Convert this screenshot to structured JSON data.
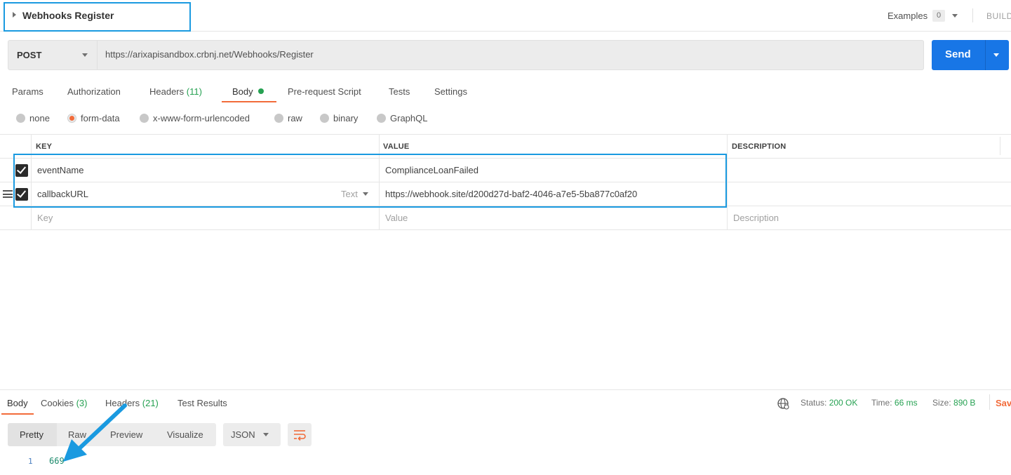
{
  "request": {
    "name": "Webhooks Register",
    "examples_label": "Examples",
    "examples_count": "0",
    "build_label": "BUILD",
    "method": "POST",
    "url": "https://arixapisandbox.crbnj.net/Webhooks/Register",
    "send_label": "Send"
  },
  "request_tabs": [
    {
      "label": "Params"
    },
    {
      "label": "Authorization"
    },
    {
      "label": "Headers",
      "count": "(11)"
    },
    {
      "label": "Body"
    },
    {
      "label": "Pre-request Script"
    },
    {
      "label": "Tests"
    },
    {
      "label": "Settings"
    }
  ],
  "body_modes": [
    {
      "label": "none",
      "selected": false
    },
    {
      "label": "form-data",
      "selected": true
    },
    {
      "label": "x-www-form-urlencoded",
      "selected": false
    },
    {
      "label": "raw",
      "selected": false
    },
    {
      "label": "binary",
      "selected": false
    },
    {
      "label": "GraphQL",
      "selected": false
    }
  ],
  "form_table": {
    "headers": {
      "key": "KEY",
      "value": "VALUE",
      "description": "DESCRIPTION"
    },
    "rows": [
      {
        "checked": true,
        "key": "eventName",
        "value": "ComplianceLoanFailed",
        "description": ""
      },
      {
        "checked": true,
        "key": "callbackURL",
        "type": "Text",
        "value": "https://webhook.site/d200d27d-baf2-4046-a7e5-5ba877c0af20",
        "description": ""
      }
    ],
    "placeholders": {
      "key": "Key",
      "value": "Value",
      "description": "Description"
    }
  },
  "response": {
    "tabs": [
      {
        "label": "Body"
      },
      {
        "label": "Cookies",
        "count": "(3)"
      },
      {
        "label": "Headers",
        "count": "(21)"
      },
      {
        "label": "Test Results"
      }
    ],
    "status_label": "Status:",
    "status_value": "200 OK",
    "time_label": "Time:",
    "time_value": "66 ms",
    "size_label": "Size:",
    "size_value": "890 B",
    "save_label": "Sav",
    "formats": [
      "Pretty",
      "Raw",
      "Preview",
      "Visualize"
    ],
    "format_type": "JSON",
    "lines": [
      {
        "num": "1",
        "text": "669"
      }
    ]
  },
  "colors": {
    "accent": "#f26b3a",
    "send_button": "#1876e6",
    "success": "#26a152",
    "annotation": "#1a9ae0"
  }
}
